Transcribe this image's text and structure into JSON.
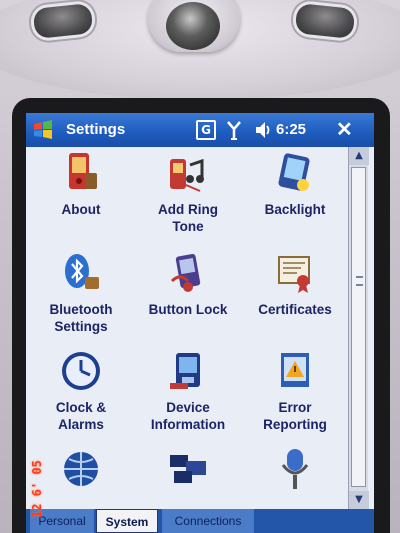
{
  "app": {
    "title": "Settings",
    "status": {
      "clock": "6:25",
      "g_icon_label": "G"
    }
  },
  "grid": {
    "items": [
      {
        "label_1": "About",
        "label_2": "",
        "icon": "about-icon"
      },
      {
        "label_1": "Add Ring",
        "label_2": "Tone",
        "icon": "ring-tone-icon"
      },
      {
        "label_1": "Backlight",
        "label_2": "",
        "icon": "backlight-icon"
      },
      {
        "label_1": "Bluetooth",
        "label_2": "Settings",
        "icon": "bluetooth-icon"
      },
      {
        "label_1": "Button Lock",
        "label_2": "",
        "icon": "button-lock-icon"
      },
      {
        "label_1": "Certificates",
        "label_2": "",
        "icon": "certificates-icon"
      },
      {
        "label_1": "Clock &",
        "label_2": "Alarms",
        "icon": "clock-icon"
      },
      {
        "label_1": "Device",
        "label_2": "Information",
        "icon": "device-info-icon"
      },
      {
        "label_1": "Error",
        "label_2": "Reporting",
        "icon": "error-reporting-icon"
      }
    ]
  },
  "tabs": {
    "personal": "Personal",
    "system": "System",
    "connections": "Connections",
    "selected": "System"
  },
  "photo": {
    "date_stamp": "12 6' 05"
  },
  "colors": {
    "titlebar": "#1f5dc0",
    "label_text": "#1c2466",
    "screen_bg": "#e9edf6",
    "tab_bar": "#2356a8"
  }
}
